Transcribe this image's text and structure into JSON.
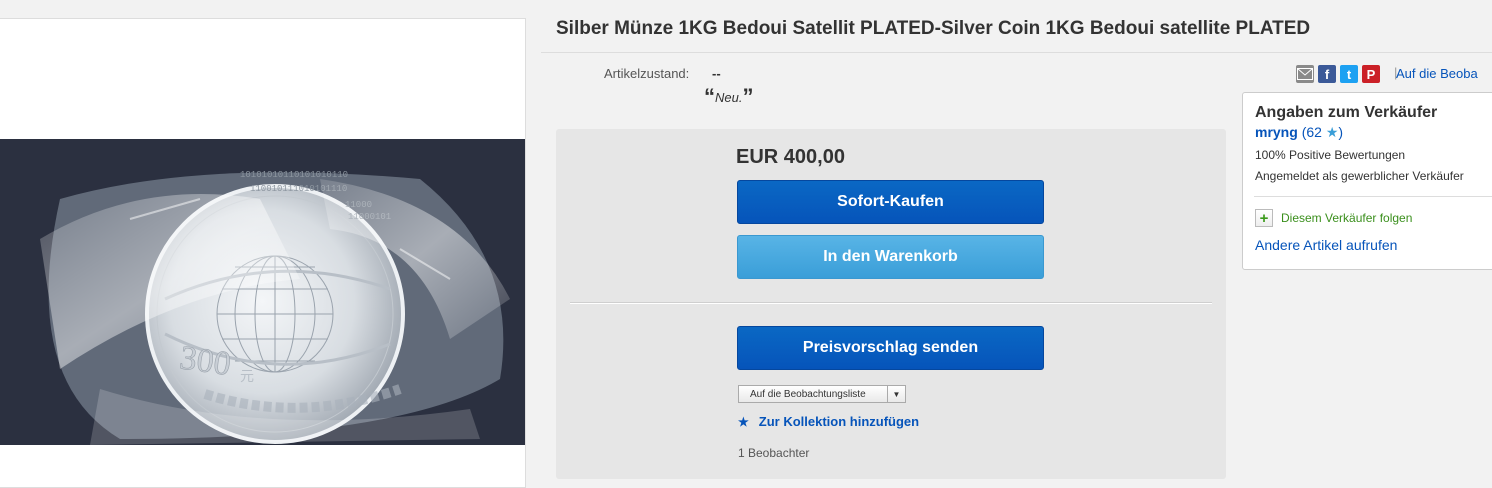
{
  "listing": {
    "title": "Silber Münze 1KG Bedoui Satellit PLATED-Silver Coin 1KG Bedoui satellite PLATED",
    "condition_label": "Artikelzustand:",
    "condition_value": "--",
    "condition_note": "Neu.",
    "quote_open": "“",
    "quote_close": "”"
  },
  "share": {
    "icons": [
      "email-icon",
      "facebook-icon",
      "twitter-icon",
      "pinterest-icon"
    ],
    "facebook_glyph": "f",
    "twitter_glyph": "t",
    "pinterest_glyph": "P",
    "separator": "|",
    "watch_link": "Auf die Beoba"
  },
  "buy": {
    "price": "EUR 400,00",
    "buy_now": "Sofort-Kaufen",
    "add_to_cart": "In den Warenkorb",
    "make_offer": "Preisvorschlag senden",
    "watchlist_select": "Auf die Beobachtungsliste",
    "collection": "Zur Kollektion hinzufügen",
    "watchers": "1 Beobachter"
  },
  "seller": {
    "heading": "Angaben zum Verkäufer",
    "name": "mryng",
    "feedback_count": "(62",
    "feedback_close": ")",
    "positive": "100% Positive Bewertungen",
    "registered": "Angemeldet als gewerblicher Verkäufer",
    "follow": "Diesem Verkäufer folgen",
    "other_items": "Andere Artikel aufrufen"
  },
  "image": {
    "coin_value_text": "300",
    "coin_value_suffix": "元",
    "coin_binary_lines": [
      "10101010110101010110",
      "110010111010101110",
      "11000",
      "11000101"
    ]
  },
  "colors": {
    "primary_button": "#0654ba",
    "secondary_button": "#3a9ed8",
    "link": "#0654ba",
    "follow_green": "#3a8f1c",
    "facebook": "#3b5998",
    "twitter": "#1da1f2",
    "pinterest": "#cb2027"
  }
}
